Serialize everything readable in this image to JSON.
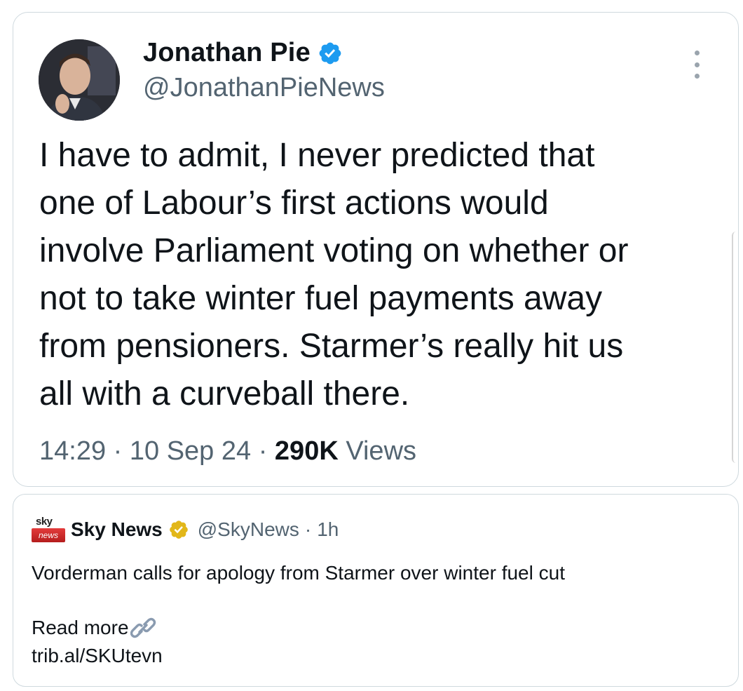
{
  "tweet": {
    "author_name": "Jonathan Pie",
    "author_handle": "@JonathanPieNews",
    "text": "I have to admit, I never predicted that\none of Labour’s first actions would\ninvolve Parliament voting on whether or\nnot to take winter fuel payments away\nfrom pensioners. Starmer’s really hit us\nall with a curveball there.",
    "time": "14:29",
    "date": "10 Sep 24",
    "views_count": "290K",
    "views_label": "Views",
    "separator": " · ",
    "verified_badge_color": "#1d9bf0",
    "more_icon": "more-vertical-icon"
  },
  "quoted": {
    "logo_top": "sky",
    "logo_bottom": "news",
    "author_name": "Sky News",
    "author_handle": "@SkyNews",
    "time_ago": "1h",
    "separator": " · ",
    "verified_badge_color": "#e2b719",
    "text": "Vorderman calls for apology from Starmer over winter fuel cut",
    "read_more": "Read more",
    "link_icon": "link-icon",
    "link": "trib.al/SKUtevn"
  },
  "colors": {
    "text_primary": "#0f1419",
    "text_secondary": "#536471",
    "border": "#cfd9de"
  }
}
